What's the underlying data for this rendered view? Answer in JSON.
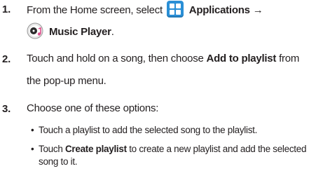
{
  "steps": [
    {
      "number": "1.",
      "line1_prefix": "From the Home screen, select",
      "applications_label": "Applications",
      "arrow": "→",
      "music_player_label": "Music Player",
      "line2_suffix": ".",
      "icons": [
        "applications-grid-icon",
        "music-player-icon"
      ]
    },
    {
      "number": "2.",
      "line1_prefix": "Touch and hold on a song, then choose",
      "bold": "Add to playlist",
      "line1_suffix": "from",
      "line2": "the pop-up menu."
    },
    {
      "number": "3.",
      "line1": "Choose one of these options:"
    }
  ],
  "bullets": [
    {
      "marker": "•",
      "text": "Touch a playlist to add the selected song to the playlist."
    },
    {
      "marker": "•",
      "bold": "Create playlist",
      "prefix": "Touch",
      "suffix": "to create a new playlist and add the selected",
      "line2": "song to it."
    }
  ],
  "colors": {
    "text": "#231f20",
    "apps_icon": "#2a8fd6",
    "music_icon_accent": "#e0508e"
  }
}
